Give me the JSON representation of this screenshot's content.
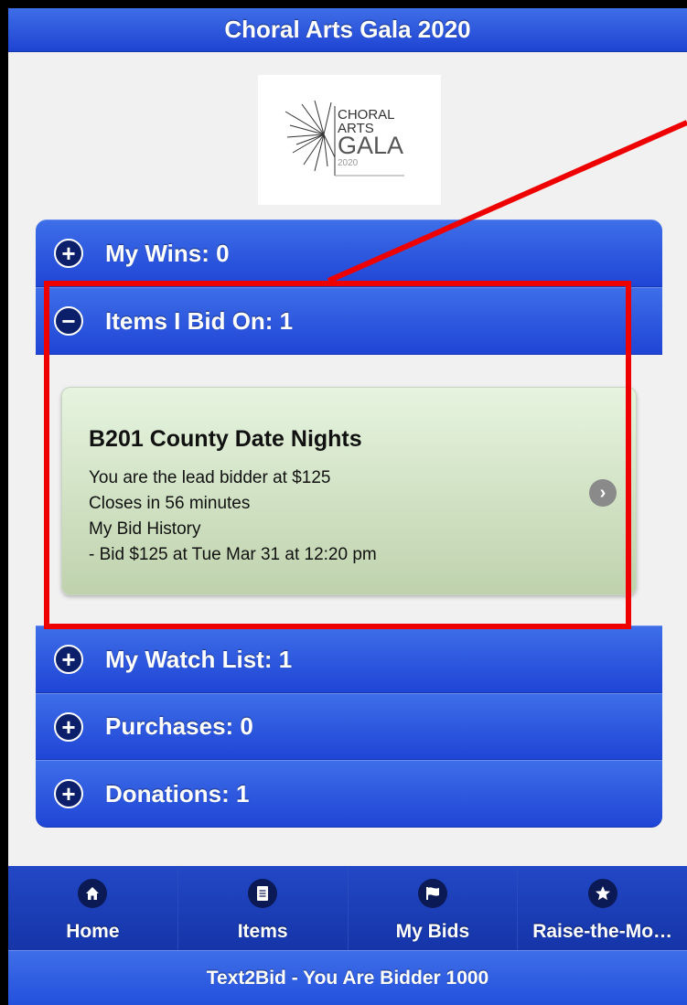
{
  "header": {
    "title": "Choral Arts Gala 2020"
  },
  "logo": {
    "line1": "CHORAL",
    "line2": "ARTS",
    "line3": "GALA",
    "line4": "2020"
  },
  "sections": {
    "wins": {
      "label": "My Wins: 0",
      "icon": "plus-icon"
    },
    "bids": {
      "label": "Items I Bid On: 1",
      "icon": "minus-icon"
    },
    "watch": {
      "label": "My Watch List: 1",
      "icon": "plus-icon"
    },
    "purchases": {
      "label": "Purchases: 0",
      "icon": "plus-icon"
    },
    "donations": {
      "label": "Donations: 1",
      "icon": "plus-icon"
    }
  },
  "bid_item": {
    "title": "B201 County Date Nights",
    "lines": [
      "You are the lead bidder at $125",
      "Closes in 56 minutes",
      "My Bid History",
      "- Bid $125 at Tue Mar 31 at 12:20 pm"
    ]
  },
  "nav": [
    {
      "label": "Home",
      "icon": "home-icon"
    },
    {
      "label": "Items",
      "icon": "document-icon"
    },
    {
      "label": "My Bids",
      "icon": "flag-icon"
    },
    {
      "label": "Raise-the-Mo…",
      "icon": "star-icon"
    }
  ],
  "footer": {
    "text": "Text2Bid - You Are Bidder 1000"
  },
  "colors": {
    "header_blue": "#2a55e0",
    "annotation_red": "#ef0000",
    "card_green": "#d8eacc"
  }
}
